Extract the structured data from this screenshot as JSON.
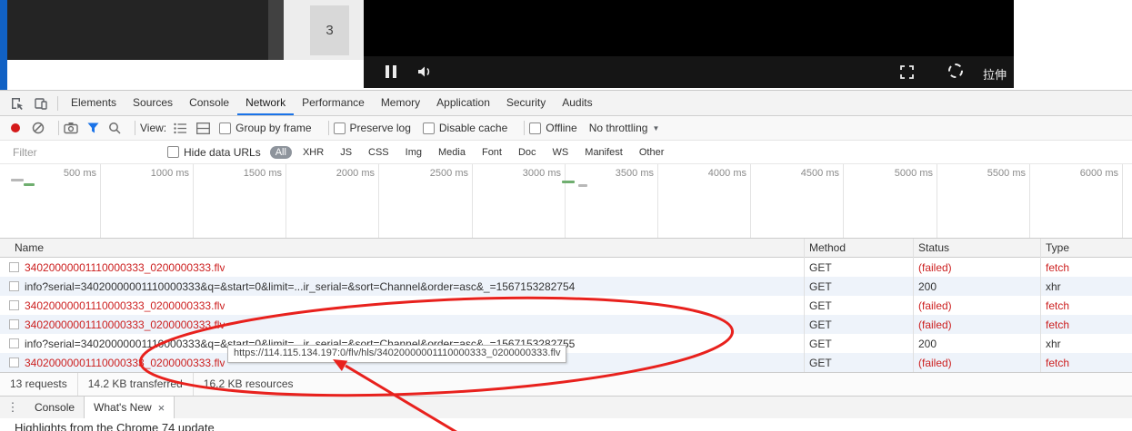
{
  "colors": {
    "accent_blue": "#1a73e8",
    "failed_red": "#cc1f1f",
    "annotation_red": "#e8211d",
    "record_red": "#d41a1a",
    "pill_bg": "#8e949c",
    "edge_blue": "#1161c4"
  },
  "player": {
    "panel_number": "3",
    "controls": {
      "stretch_label": "拉伸"
    }
  },
  "devtools": {
    "tabs": [
      {
        "label": "Elements"
      },
      {
        "label": "Sources"
      },
      {
        "label": "Console"
      },
      {
        "label": "Network"
      },
      {
        "label": "Performance"
      },
      {
        "label": "Memory"
      },
      {
        "label": "Application"
      },
      {
        "label": "Security"
      },
      {
        "label": "Audits"
      }
    ],
    "toolbar": {
      "view_label": "View:",
      "group_by_frame_label": "Group by frame",
      "preserve_log_label": "Preserve log",
      "disable_cache_label": "Disable cache",
      "offline_label": "Offline",
      "throttling_label": "No throttling",
      "throttling_caret": "▼"
    },
    "filter_bar": {
      "filter_placeholder": "Filter",
      "hide_data_urls_label": "Hide data URLs",
      "pills": [
        "All",
        "XHR",
        "JS",
        "CSS",
        "Img",
        "Media",
        "Font",
        "Doc",
        "WS",
        "Manifest",
        "Other"
      ]
    },
    "timeline": {
      "ticks": [
        "500 ms",
        "1000 ms",
        "1500 ms",
        "2000 ms",
        "2500 ms",
        "3000 ms",
        "3500 ms",
        "4000 ms",
        "4500 ms",
        "5000 ms",
        "5500 ms",
        "6000 ms"
      ]
    },
    "table": {
      "columns": [
        "Name",
        "Method",
        "Status",
        "Type"
      ],
      "rows": [
        {
          "name": "34020000001110000333_0200000333.flv",
          "method": "GET",
          "status": "(failed)",
          "type": "fetch"
        },
        {
          "name": "info?serial=34020000001110000333&q=&start=0&limit=...ir_serial=&sort=Channel&order=asc&_=1567153282754",
          "method": "GET",
          "status": "200",
          "type": "xhr"
        },
        {
          "name": "34020000001110000333_0200000333.flv",
          "method": "GET",
          "status": "(failed)",
          "type": "fetch"
        },
        {
          "name": "34020000001110000333_0200000333.flv",
          "method": "GET",
          "status": "(failed)",
          "type": "fetch"
        },
        {
          "name": "info?serial=34020000001110000333&q=&start=0&limit=...ir_serial=&sort=Channel&order=asc&_=1567153282755",
          "method": "GET",
          "status": "200",
          "type": "xhr"
        },
        {
          "name": "34020000001110000333_0200000333.flv",
          "method": "GET",
          "status": "(failed)",
          "type": "fetch"
        }
      ]
    },
    "summary": {
      "requests": "13 requests",
      "transferred": "14.2 KB transferred",
      "resources": "16.2 KB resources"
    },
    "tooltip_url": "https://114.115.134.197:0/flv/hls/34020000001110000333_0200000333.flv",
    "drawer": {
      "console_label": "Console",
      "whats_new_label": "What's New",
      "close_glyph": "×"
    },
    "whats_new": {
      "heading": "Highlights from the Chrome 74 update"
    }
  }
}
